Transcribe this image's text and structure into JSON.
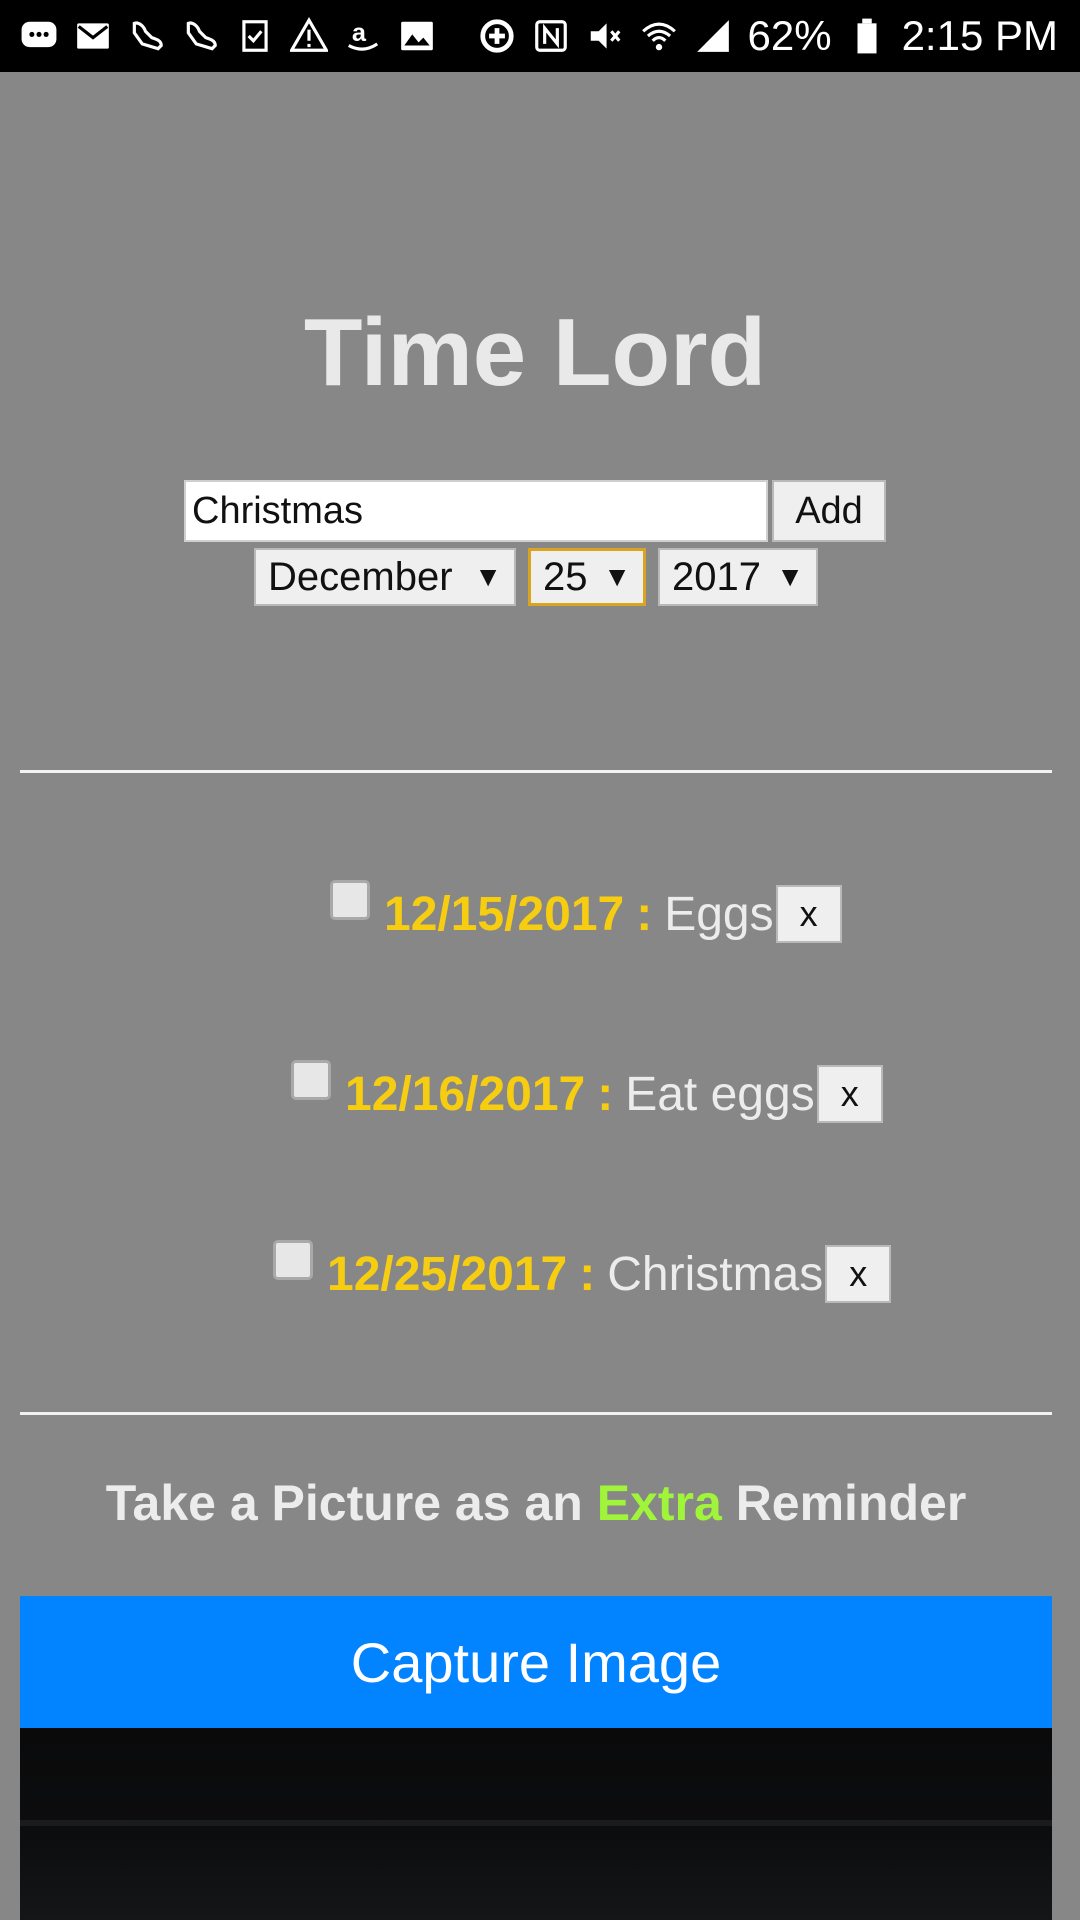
{
  "status_bar": {
    "icons_left": [
      "chat-icon",
      "mail-icon",
      "shoe-icon",
      "shoe-icon",
      "checklist-icon",
      "warning-icon",
      "amazon-icon",
      "image-icon"
    ],
    "icons_right": [
      "sync-icon",
      "nfc-icon",
      "vibrate-icon",
      "wifi-icon",
      "signal-icon"
    ],
    "battery": "62%",
    "time": "2:15 PM"
  },
  "app": {
    "title": "Time Lord"
  },
  "add_form": {
    "task_value": "Christmas",
    "add_label": "Add",
    "month": "December",
    "day": "25",
    "year": "2017",
    "arrow": "▼"
  },
  "tasks": [
    {
      "date": "12/15/2017",
      "separator": ":",
      "name": "Eggs",
      "remove_label": "x",
      "checked": false
    },
    {
      "date": "12/16/2017",
      "separator": ":",
      "name": "Eat eggs",
      "remove_label": "x",
      "checked": false
    },
    {
      "date": "12/25/2017",
      "separator": ":",
      "name": "Christmas",
      "remove_label": "x",
      "checked": false
    }
  ],
  "reminder": {
    "prefix": "Take a Picture as an",
    "accent": "Extra",
    "suffix": "Reminder"
  },
  "capture": {
    "label": "Capture Image"
  },
  "colors": {
    "background": "#878787",
    "date_yellow": "#f7cd12",
    "accent_green": "#a0f53a",
    "capture_blue": "#0283ff"
  }
}
